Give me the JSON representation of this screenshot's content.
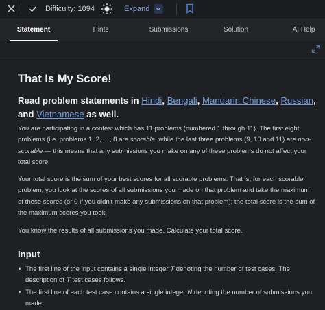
{
  "topbar": {
    "difficulty_label": "Difficulty: 1094",
    "expand_label": "Expand"
  },
  "tabs": [
    {
      "label": "Statement",
      "active": true
    },
    {
      "label": "Hints"
    },
    {
      "label": "Submissions"
    },
    {
      "label": "Solution"
    },
    {
      "label": "AI Help"
    }
  ],
  "problem": {
    "title": "That Is My Score!",
    "lang_intro": "Read problem statements in",
    "languages": [
      "Hindi",
      "Bengali",
      "Mandarin Chinese",
      "Russian",
      "Vietnamese"
    ],
    "lang_sep": ",",
    "lang_and": "and",
    "lang_outro": "as well.",
    "para1": {
      "t1": "You are participating in a contest which has",
      "n11": "11",
      "t2": "problems (numbered",
      "n1": "1",
      "t3": "through",
      "n11b": "11",
      "t4": "). The first eight problems (i.e. problems",
      "range": "1, 2, …, 8",
      "t5": "are",
      "scorable": "scorable",
      "t6": ", while the last three problems (",
      "n9": "9",
      "t7": ",",
      "n10": "10",
      "t8": "and",
      "n11c": "11",
      "t9": ") are",
      "nonscorable": "non-scorable",
      "t10": "— this means that any submissions you make on any of these problems do not affect your total score."
    },
    "para2": "Your total score is the sum of your best scores for all scorable problems. That is, for each scorable problem, you look at the scores of all submissions you made on that problem and take the maximum of these scores (or 0 if you didn't make any submissions on that problem); the total score is the sum of the maximum scores you took.",
    "para3": "You know the results of all submissions you made. Calculate your total score.",
    "input_heading": "Input",
    "input_items": [
      {
        "a": "The first line of the input contains a single integer",
        "v": "T",
        "b": "denoting the number of test cases. The description of",
        "v2": "T",
        "c": "test cases follows."
      },
      {
        "a": "The first line of each test case contains a single integer",
        "v": "N",
        "b": "denoting the number of submissions you made."
      }
    ]
  }
}
